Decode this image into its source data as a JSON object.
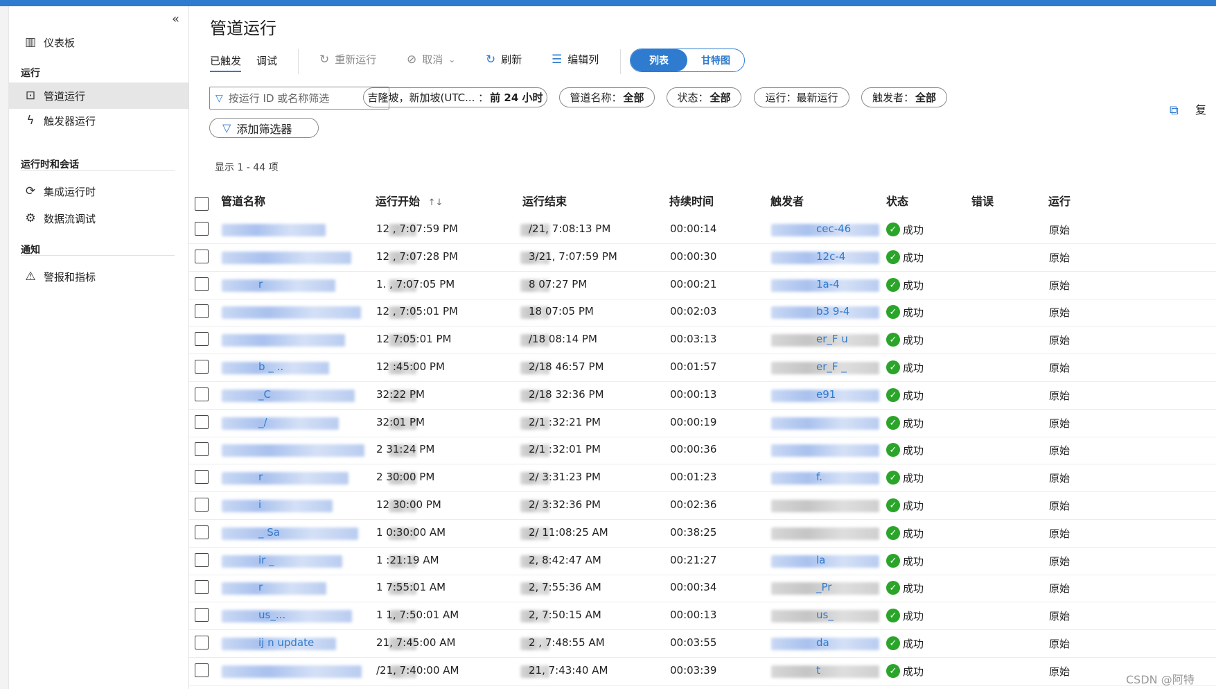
{
  "sidebar": {
    "collapse_icon": "«",
    "items": [
      {
        "label": "仪表板",
        "icon": "dashboard-icon"
      },
      {
        "label": "管道运行",
        "icon": "pipeline-icon"
      },
      {
        "label": "触发器运行",
        "icon": "trigger-icon"
      },
      {
        "label": "集成运行时",
        "icon": "integration-runtime-icon"
      },
      {
        "label": "数据流调试",
        "icon": "dataflow-icon"
      },
      {
        "label": "警报和指标",
        "icon": "alert-icon"
      }
    ],
    "sections": [
      "运行",
      "运行时和会话",
      "通知"
    ]
  },
  "page": {
    "title": "管道运行",
    "tabs": [
      "已触发",
      "调试"
    ],
    "toolbar": {
      "rerun": "重新运行",
      "cancel": "取消",
      "refresh": "刷新",
      "edit_columns": "编辑列"
    },
    "view_toggle": {
      "list": "列表",
      "gantt": "甘特图"
    },
    "search_placeholder": "按运行 ID 或名称筛选",
    "filters": {
      "timezone_prefix": "吉隆坡，新加坡(UTC... ：",
      "timezone_value": "前 24 小时",
      "pipeline_prefix": "管道名称：",
      "pipeline_value": "全部",
      "status_prefix": "状态：",
      "status_value": "全部",
      "run_prefix": "运行：",
      "run_value": "最新运行",
      "trigger_prefix": "触发者：",
      "trigger_value": "全部"
    },
    "add_filter": "添加筛选器",
    "copy_label": "复",
    "showing": "显示 1 - 44 项"
  },
  "table": {
    "headers": {
      "name": "管道名称",
      "start": "运行开始",
      "sort_icon": "↑↓",
      "end": "运行结束",
      "duration": "持续时间",
      "trigger": "触发者",
      "status": "状态",
      "error": "错误",
      "run": "运行"
    },
    "rows": [
      {
        "start": "12 , 7:07:59 PM",
        "end": "/21, 7:08:13 PM",
        "duration": "00:00:14",
        "trigger_frag": "cec-46",
        "status": "成功",
        "run": "原始"
      },
      {
        "start": "12 , 7:07:28 PM",
        "end": "3/21, 7:07:59 PM",
        "duration": "00:00:30",
        "trigger_frag": "12c-4",
        "status": "成功",
        "run": "原始"
      },
      {
        "start": "1. , 7:07:05 PM",
        "end": "8 07:27 PM",
        "duration": "00:00:21",
        "trigger_frag": "1a-4",
        "status": "成功",
        "run": "原始"
      },
      {
        "start": "12 , 7:05:01 PM",
        "end": "18 07:05 PM",
        "duration": "00:02:03",
        "trigger_frag": "b3 9-4",
        "status": "成功",
        "run": "原始"
      },
      {
        "start": "12 7:05:01 PM",
        "end": "/18 08:14 PM",
        "duration": "00:03:13",
        "trigger_frag": "er_F u",
        "status": "成功",
        "run": "原始"
      },
      {
        "start": "12 :45:00 PM",
        "end": "2/18 46:57 PM",
        "duration": "00:01:57",
        "trigger_frag": "er_F _",
        "status": "成功",
        "run": "原始"
      },
      {
        "start": "32:22 PM",
        "end": "2/18 32:36 PM",
        "duration": "00:00:13",
        "trigger_frag": "e91",
        "status": "成功",
        "run": "原始"
      },
      {
        "start": "32:01 PM",
        "end": "2/1 :32:21 PM",
        "duration": "00:00:19",
        "trigger_frag": "",
        "status": "成功",
        "run": "原始"
      },
      {
        "start": "2 31:24 PM",
        "end": "2/1 :32:01 PM",
        "duration": "00:00:36",
        "trigger_frag": "",
        "status": "成功",
        "run": "原始"
      },
      {
        "start": "2 30:00 PM",
        "end": "2/ 3:31:23 PM",
        "duration": "00:01:23",
        "trigger_frag": "f.",
        "status": "成功",
        "run": "原始"
      },
      {
        "start": "12 30:00 PM",
        "end": "2/ 3:32:36 PM",
        "duration": "00:02:36",
        "trigger_frag": "",
        "status": "成功",
        "run": "原始"
      },
      {
        "start": "1 0:30:00 AM",
        "end": "2/ 11:08:25 AM",
        "duration": "00:38:25",
        "trigger_frag": "",
        "status": "成功",
        "run": "原始"
      },
      {
        "start": "1 :21:19 AM",
        "end": "2, 8:42:47 AM",
        "duration": "00:21:27",
        "trigger_frag": "la",
        "status": "成功",
        "run": "原始"
      },
      {
        "start": "1 7:55:01 AM",
        "end": "2, 7:55:36 AM",
        "duration": "00:00:34",
        "trigger_frag": "_Pr",
        "status": "成功",
        "run": "原始"
      },
      {
        "start": "1 1, 7:50:01 AM",
        "end": "2, 7:50:15 AM",
        "duration": "00:00:13",
        "trigger_frag": "us_",
        "status": "成功",
        "run": "原始"
      },
      {
        "start": "21, 7:45:00 AM",
        "end": "2 , 7:48:55 AM",
        "duration": "00:03:55",
        "trigger_frag": "da",
        "status": "成功",
        "run": "原始"
      },
      {
        "start": "/21, 7:40:00 AM",
        "end": "21, 7:43:40 AM",
        "duration": "00:03:39",
        "trigger_frag": "t",
        "status": "成功",
        "run": "原始"
      }
    ],
    "name_frags": [
      "",
      "",
      "r",
      "",
      "",
      "b _ ..",
      "_C",
      "_/",
      "",
      "r",
      "i ",
      "_ Sa",
      "ir _",
      "r",
      "us_...",
      "ij n update",
      ""
    ]
  },
  "watermark": "CSDN @阿特",
  "colors": {
    "accent": "#2e7bcf",
    "success": "#2aa52a"
  }
}
